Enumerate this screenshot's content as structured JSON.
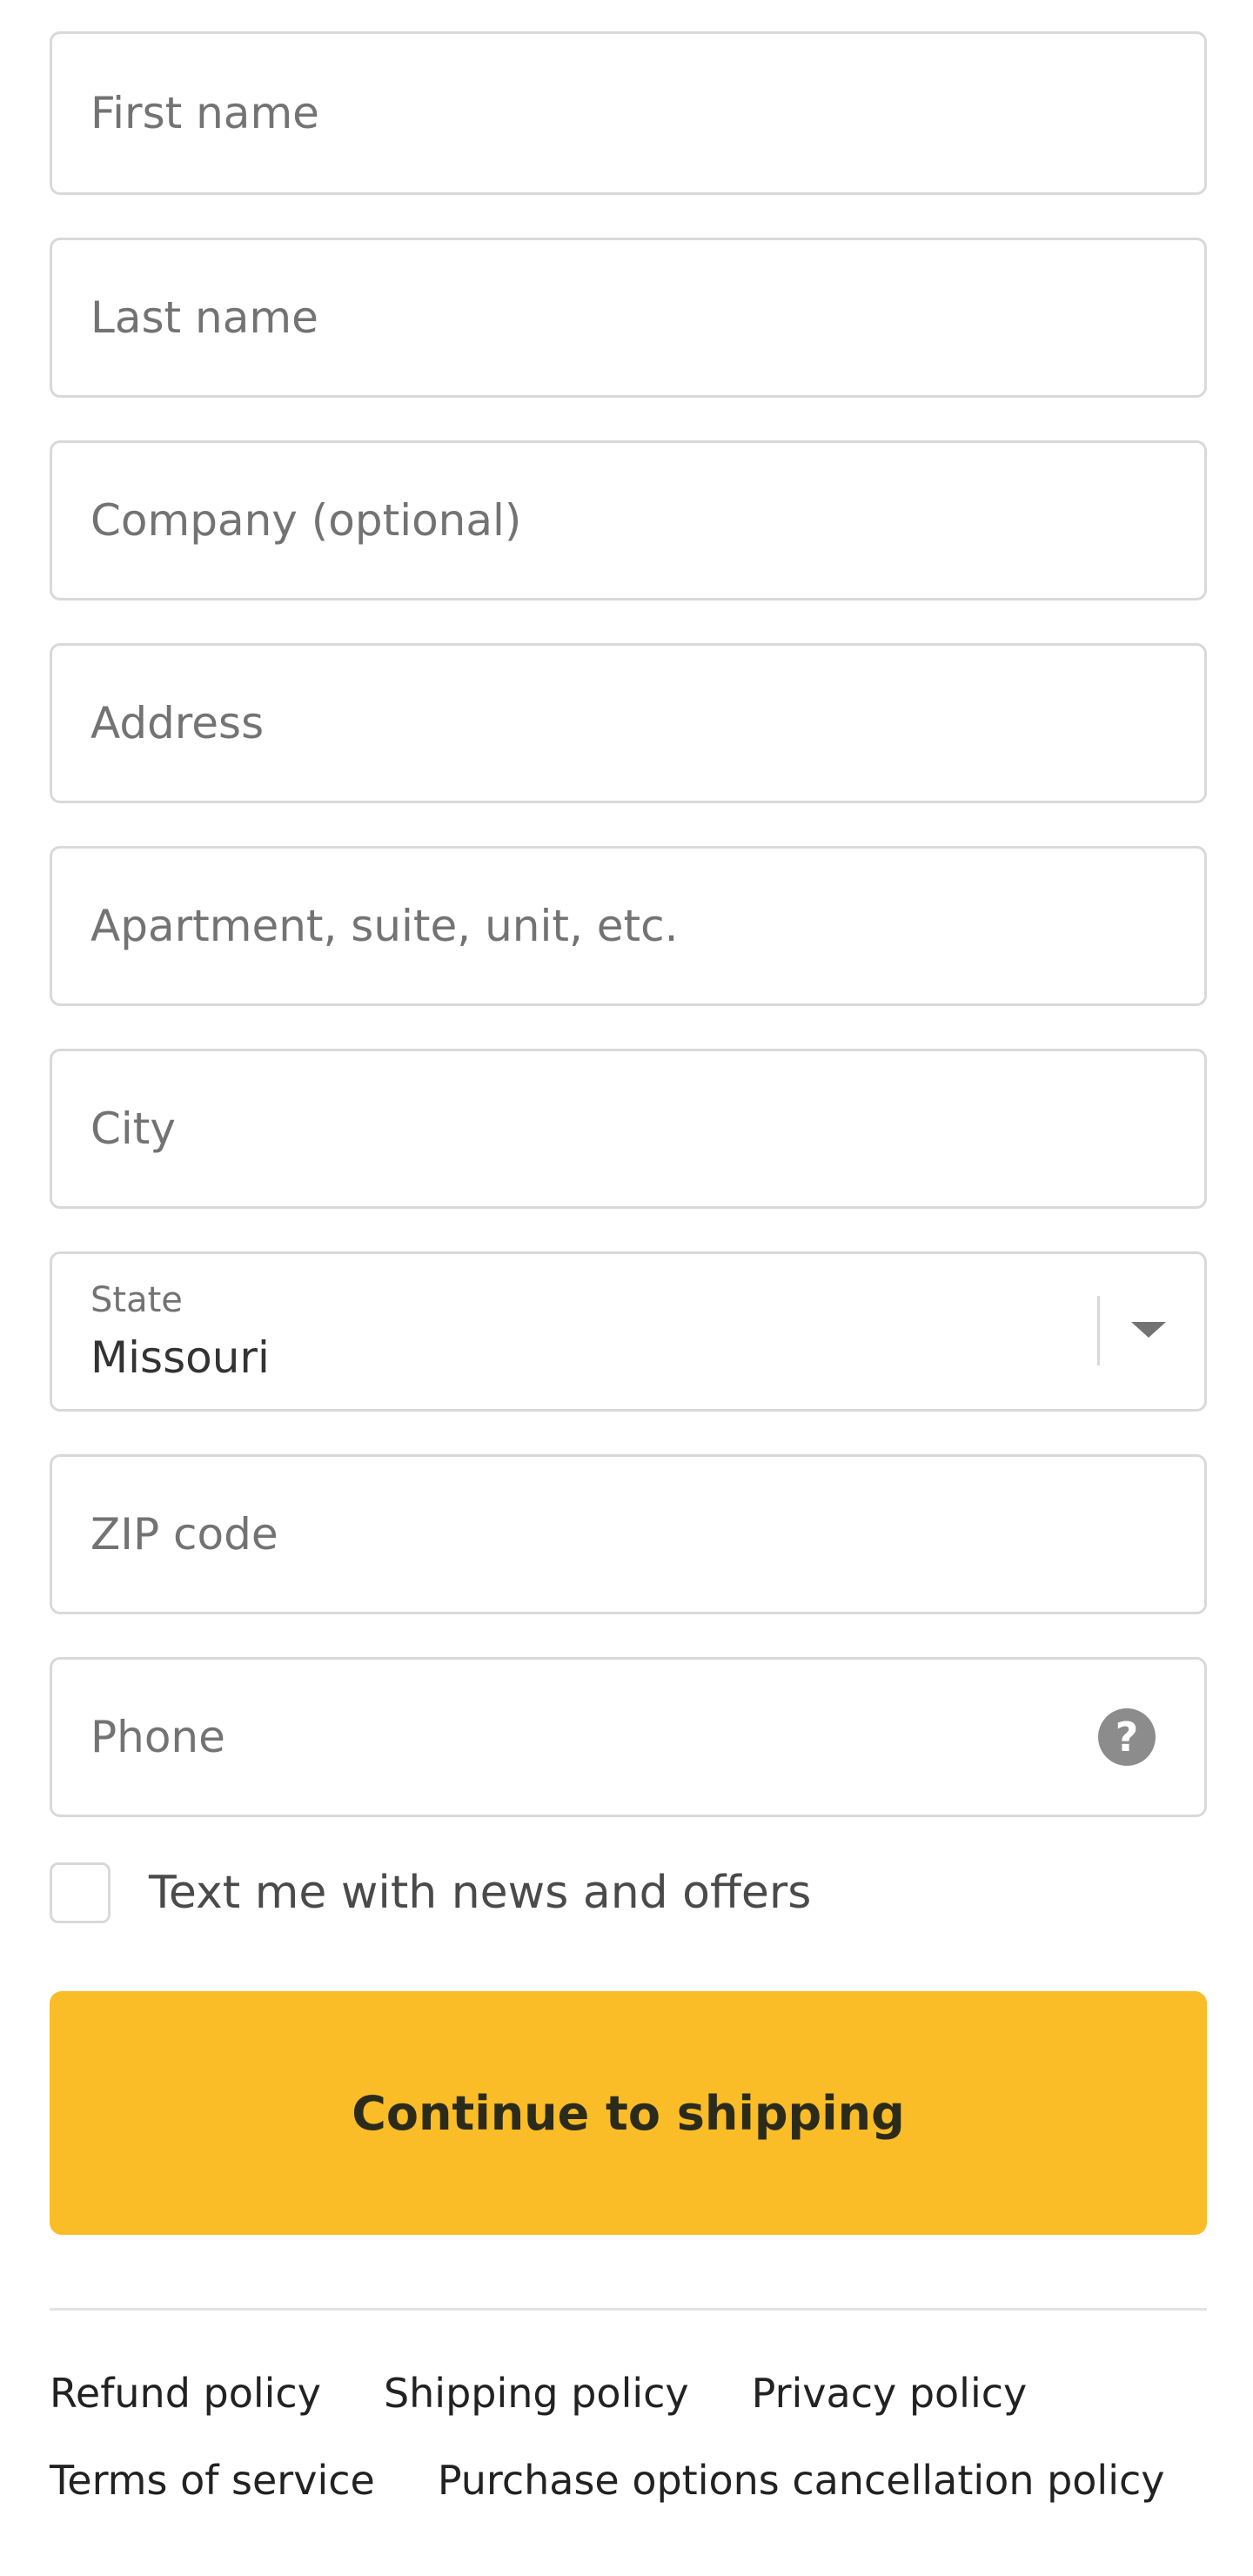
{
  "form": {
    "first_name_placeholder": "First name",
    "last_name_placeholder": "Last name",
    "company_placeholder": "Company (optional)",
    "address_placeholder": "Address",
    "apartment_placeholder": "Apartment, suite, unit, etc.",
    "city_placeholder": "City",
    "state_label": "State",
    "state_value": "Missouri",
    "zip_placeholder": "ZIP code",
    "phone_placeholder": "Phone",
    "phone_help_glyph": "?",
    "phone_help_icon": "question-circle-icon",
    "state_dropdown_icon": "chevron-down-icon"
  },
  "marketing": {
    "checkbox_checked": false,
    "checkbox_label": "Text me with news and offers"
  },
  "actions": {
    "continue_label": "Continue to shipping",
    "continue_color": "#fabc27"
  },
  "footer": {
    "links_row1": [
      "Refund policy",
      "Shipping policy",
      "Privacy policy"
    ],
    "links_row2": [
      "Terms of service",
      "Purchase options cancellation policy"
    ]
  }
}
